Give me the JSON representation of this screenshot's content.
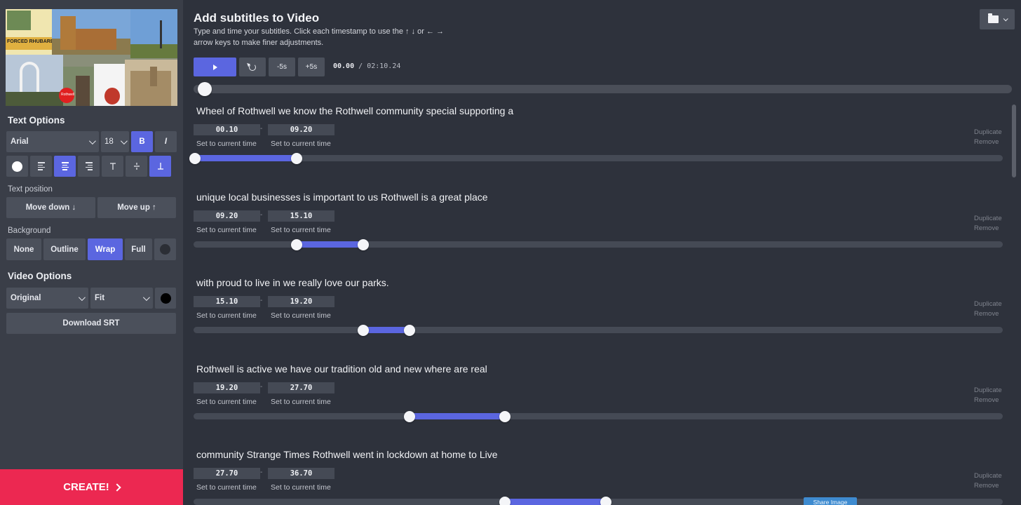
{
  "left_panel": {
    "text_options_title": "Text Options",
    "font": "Arial",
    "font_size": "18",
    "bold_label": "B",
    "italic_label": "I",
    "text_position_label": "Text position",
    "move_down_label": "Move down ↓",
    "move_up_label": "Move up ↑",
    "background_label": "Background",
    "background_options": [
      "None",
      "Outline",
      "Wrap",
      "Full"
    ],
    "background_selected": "Wrap",
    "text_align_selected": "center",
    "vertical_align_selected": "bottom",
    "text_color": "#ffffff",
    "background_color": "#2b2e35",
    "video_options_title": "Video Options",
    "aspect": "Original",
    "fit": "Fit",
    "video_bg_color": "#000000",
    "download_srt_label": "Download SRT",
    "create_label": "CREATE!",
    "thumbnail_text": [
      "FORCED RHUBARB",
      "Rothwell"
    ]
  },
  "main": {
    "title": "Add subtitles to Video",
    "description": "Type and time your subtitles. Click each timestamp to use the ↑ ↓ or ← → arrow keys to make finer adjustments.",
    "controls": {
      "play_icon": "play-icon",
      "replay_icon": "replay-icon",
      "back_label": "-5s",
      "forward_label": "+5s"
    },
    "current_time": "00.00",
    "separator": "/",
    "duration": "02:10.24",
    "set_current_label": "Set to current time",
    "duplicate_label": "Duplicate",
    "remove_label": "Remove",
    "share_label": "Share Image",
    "accent_color": "#5b66e0"
  },
  "subtitles": [
    {
      "text": "Wheel of Rothwell we know the Rothwell community special supporting a",
      "start": "00.10",
      "end": "09.20"
    },
    {
      "text": "unique local businesses is important to us Rothwell is a great place",
      "start": "09.20",
      "end": "15.10"
    },
    {
      "text": "with proud to live in we really love our parks.",
      "start": "15.10",
      "end": "19.20"
    },
    {
      "text": "Rothwell is active we have our tradition old and new where are real",
      "start": "19.20",
      "end": "27.70"
    },
    {
      "text": "community Strange Times Rothwell went in lockdown at home to Live",
      "start": "27.70",
      "end": "36.70"
    }
  ]
}
